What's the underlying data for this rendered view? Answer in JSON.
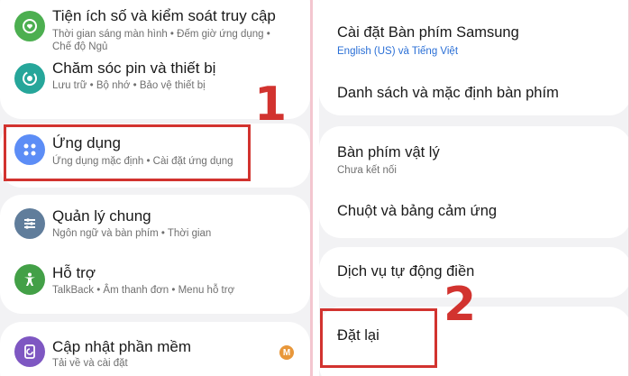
{
  "left_panel": {
    "items": [
      {
        "title": "Tiện ích số và kiểm soát truy cập",
        "subtitle_line1": "Thời gian sáng màn hình  •  Đếm giờ ứng dụng  •",
        "subtitle_line2": "Chế độ Ngủ",
        "icon": "digital-wellbeing-icon",
        "icon_color": "#4caf50"
      },
      {
        "title": "Chăm sóc pin và thiết bị",
        "subtitle": "Lưu trữ  •  Bộ nhớ  •  Bảo vệ thiết bị",
        "icon": "device-care-icon",
        "icon_color": "#26a69a"
      },
      {
        "title": "Ứng dụng",
        "subtitle": "Ứng dụng mặc định  •  Cài đặt ứng dụng",
        "icon": "apps-icon",
        "icon_color": "#5c8df6"
      },
      {
        "title": "Quản lý chung",
        "subtitle": "Ngôn ngữ và bàn phím  •  Thời gian",
        "icon": "general-management-icon",
        "icon_color": "#607d9b"
      },
      {
        "title": "Hỗ trợ",
        "subtitle": "TalkBack  •  Âm thanh đơn  •  Menu hỗ trợ",
        "icon": "accessibility-icon",
        "icon_color": "#43a047"
      },
      {
        "title": "Cập nhật phần mềm",
        "subtitle": "Tải về và cài đặt",
        "icon": "software-update-icon",
        "icon_color": "#7e57c2",
        "badge": "M",
        "badge_color": "#e8973a"
      }
    ],
    "annotation_number": "1"
  },
  "right_panel": {
    "items": [
      {
        "title": "Cài đặt Bàn phím Samsung",
        "subtitle": "English (US) và Tiếng Việt",
        "subtitle_color": "#2a6fd6"
      },
      {
        "title": "Danh sách và mặc định bàn phím"
      },
      {
        "title": "Bàn phím vật lý",
        "subtitle": "Chưa kết nối",
        "subtitle_color": "#707070"
      },
      {
        "title": "Chuột và bảng cảm ứng"
      },
      {
        "title": "Dịch vụ tự động điền"
      },
      {
        "title": "Đặt lại"
      }
    ],
    "annotation_number": "2"
  },
  "colors": {
    "highlight": "#d2332f",
    "background": "#f2f2f4",
    "card": "#ffffff"
  }
}
